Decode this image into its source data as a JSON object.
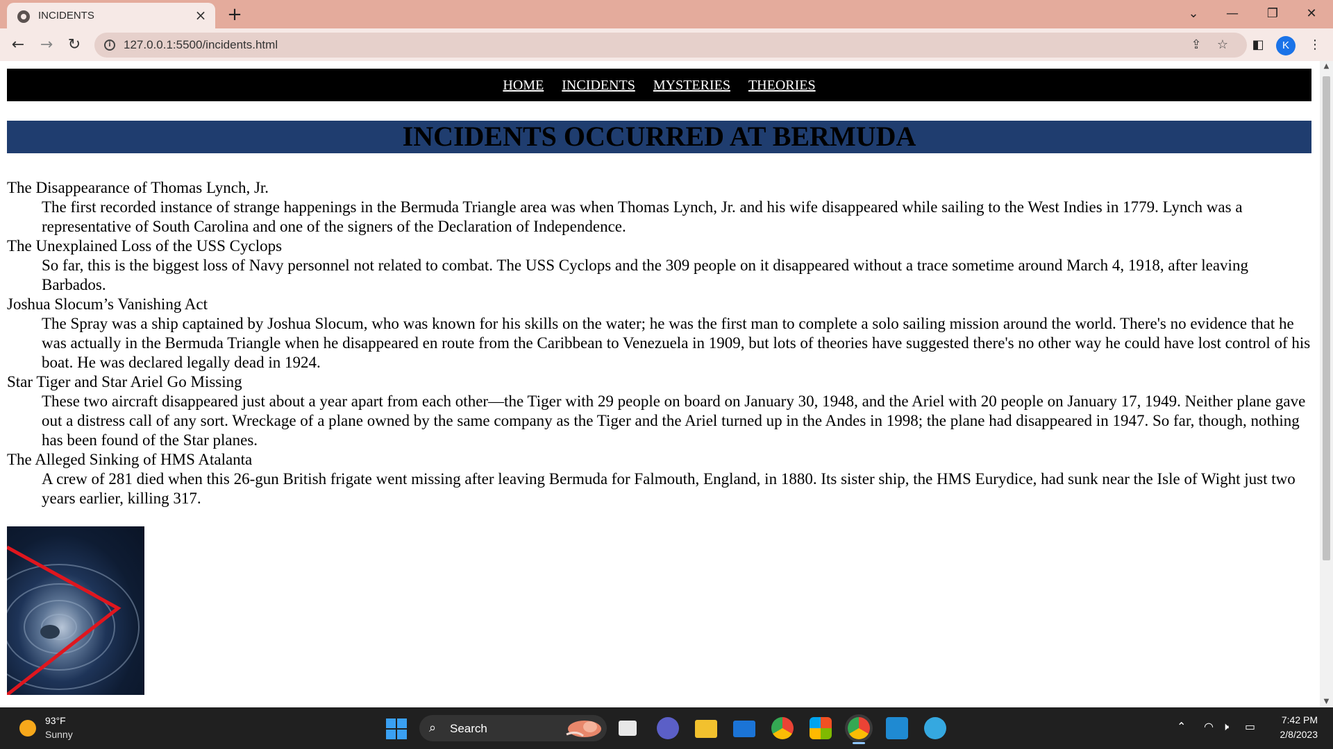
{
  "browser": {
    "tab_title": "INCIDENTS",
    "url": "127.0.0.1:5500/incidents.html",
    "profile_initial": "K"
  },
  "page": {
    "nav": [
      "HOME",
      "INCIDENTS",
      "MYSTERIES",
      "THEORIES"
    ],
    "heading": "INCIDENTS OCCURRED AT BERMUDA",
    "incidents": [
      {
        "title": "The Disappearance of Thomas Lynch, Jr.",
        "text": "The first recorded instance of strange happenings in the Bermuda Triangle area was when Thomas Lynch, Jr. and his wife disappeared while sailing to the West Indies in 1779. Lynch was a representative of South Carolina and one of the signers of the Declaration of Independence."
      },
      {
        "title": "The Unexplained Loss of the USS Cyclops",
        "text": "So far, this is the biggest loss of Navy personnel not related to combat. The USS Cyclops and the 309 people on it disappeared without a trace sometime around March 4, 1918, after leaving Barbados."
      },
      {
        "title": "Joshua Slocum’s Vanishing Act",
        "text": "The Spray was a ship captained by Joshua Slocum, who was known for his skills on the water; he was the first man to complete a solo sailing mission around the world. There's no evidence that he was actually in the Bermuda Triangle when he disappeared en route from the Caribbean to Venezuela in 1909, but lots of theories have suggested there's no other way he could have lost control of his boat. He was declared legally dead in 1924."
      },
      {
        "title": "Star Tiger and Star Ariel Go Missing",
        "text": "These two aircraft disappeared just about a year apart from each other—the Tiger with 29 people on board on January 30, 1948, and the Ariel with 20 people on January 17, 1949. Neither plane gave out a distress call of any sort. Wreckage of a plane owned by the same company as the Tiger and the Ariel turned up in the Andes in 1998; the plane had disappeared in 1947. So far, though, nothing has been found of the Star planes."
      },
      {
        "title": "The Alleged Sinking of HMS Atalanta",
        "text": "A crew of 281 died when this 26-gun British frigate went missing after leaving Bermuda for Falmouth, England, in 1880. Its sister ship, the HMS Eurydice, had sunk near the Isle of Wight just two years earlier, killing 317."
      }
    ]
  },
  "taskbar": {
    "temperature": "93°F",
    "weather": "Sunny",
    "search_label": "Search",
    "time": "7:42 PM",
    "date": "2/8/2023"
  },
  "colors": {
    "tabstrip": "#e4ab9c",
    "nav_bar": "#000000",
    "heading_bar": "#1f3d6f",
    "triangle_line": "#e0161e"
  }
}
